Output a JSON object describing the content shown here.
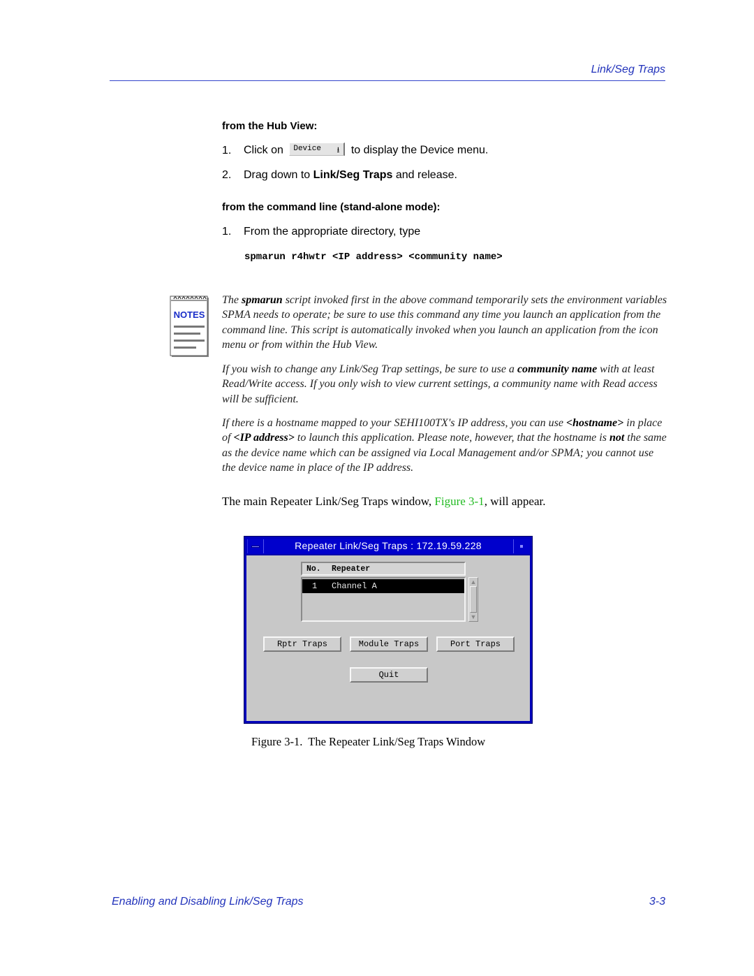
{
  "header": {
    "running_head": "Link/Seg Traps"
  },
  "hub_view": {
    "heading": "from the Hub View:",
    "step1": {
      "num": "1.",
      "before": "Click on",
      "button_label": "Device",
      "button_icon": "dropdown-arrow-icon",
      "after": "to display the Device menu."
    },
    "step2": {
      "num": "2.",
      "before": "Drag down to ",
      "bold": "Link/Seg Traps",
      "after": " and release."
    }
  },
  "command_line": {
    "heading": "from the command line (stand-alone mode):",
    "step1": {
      "num": "1.",
      "text": "From the appropriate directory, type"
    },
    "command": "spmarun r4hwtr <IP address> <community name>"
  },
  "notes": {
    "icon_label": "NOTES",
    "para1": {
      "t1": "The ",
      "b1": "spmarun",
      "t2": " script invoked first in the above command temporarily sets the environment variables SPMA needs to operate; be sure to use this command any time you launch an application from the command line. This script is automatically invoked when you launch an application from the icon menu or from within the Hub View."
    },
    "para2": {
      "t1": "If you wish to change any Link/Seg Trap settings, be sure to use a ",
      "b1": "community name",
      "t2": " with at least Read/Write access. If you only wish to view current settings, a community name with Read access will be sufficient."
    },
    "para3": {
      "t1": "If there is a hostname mapped to your SEHI100TX's IP address, you can use ",
      "b1": "<hostname>",
      "t2": " in place of ",
      "b2": "<IP address>",
      "t3": " to launch this application. Please note, however, that the hostname is ",
      "b3": "not",
      "t4": " the same as the device name which can be assigned via Local Management and/or SPMA; you cannot use the device name in place of the IP address."
    }
  },
  "main_para": {
    "before": "The main Repeater Link/Seg Traps window, ",
    "link": "Figure 3-1",
    "after": ", will appear."
  },
  "window": {
    "title": "Repeater Link/Seg Traps : 172.19.59.228",
    "list_headers": [
      "No.",
      "Repeater"
    ],
    "rows": [
      {
        "no": "1",
        "repeater": "Channel A",
        "selected": true
      }
    ],
    "scroll_up": "▲",
    "scroll_down": "▼",
    "buttons": {
      "rptr_traps": "Rptr Traps",
      "module_traps": "Module Traps",
      "port_traps": "Port Traps",
      "quit": "Quit"
    }
  },
  "figure_caption": "Figure 3-1.  The Repeater Link/Seg Traps Window",
  "footer": {
    "left": "Enabling and Disabling Link/Seg Traps",
    "right": "3-3"
  },
  "colors": {
    "accent_blue": "#2233bb",
    "link_green": "#22bb22",
    "window_frame": "#0000cc"
  }
}
